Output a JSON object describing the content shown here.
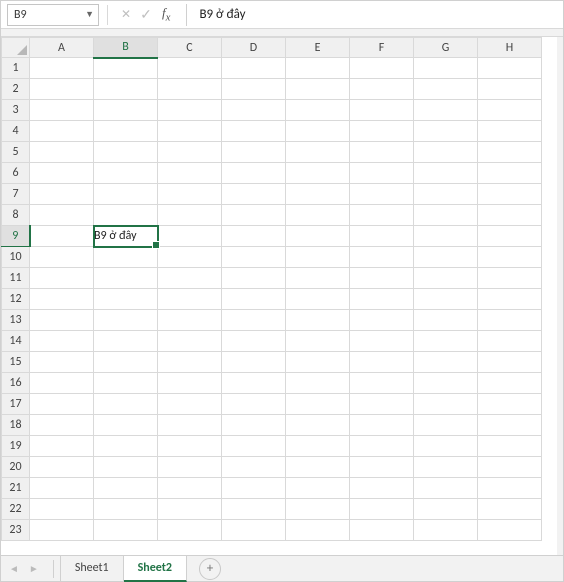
{
  "name_box": {
    "value": "B9"
  },
  "formula_bar": {
    "value": "B9 ở đây"
  },
  "columns": [
    "A",
    "B",
    "C",
    "D",
    "E",
    "F",
    "G",
    "H"
  ],
  "row_count": 23,
  "active_cell": {
    "col": "B",
    "row": 9,
    "value": "B9 ở đây"
  },
  "tabs": [
    "Sheet1",
    "Sheet2"
  ],
  "active_tab": "Sheet2",
  "colors": {
    "accent": "#217346"
  }
}
